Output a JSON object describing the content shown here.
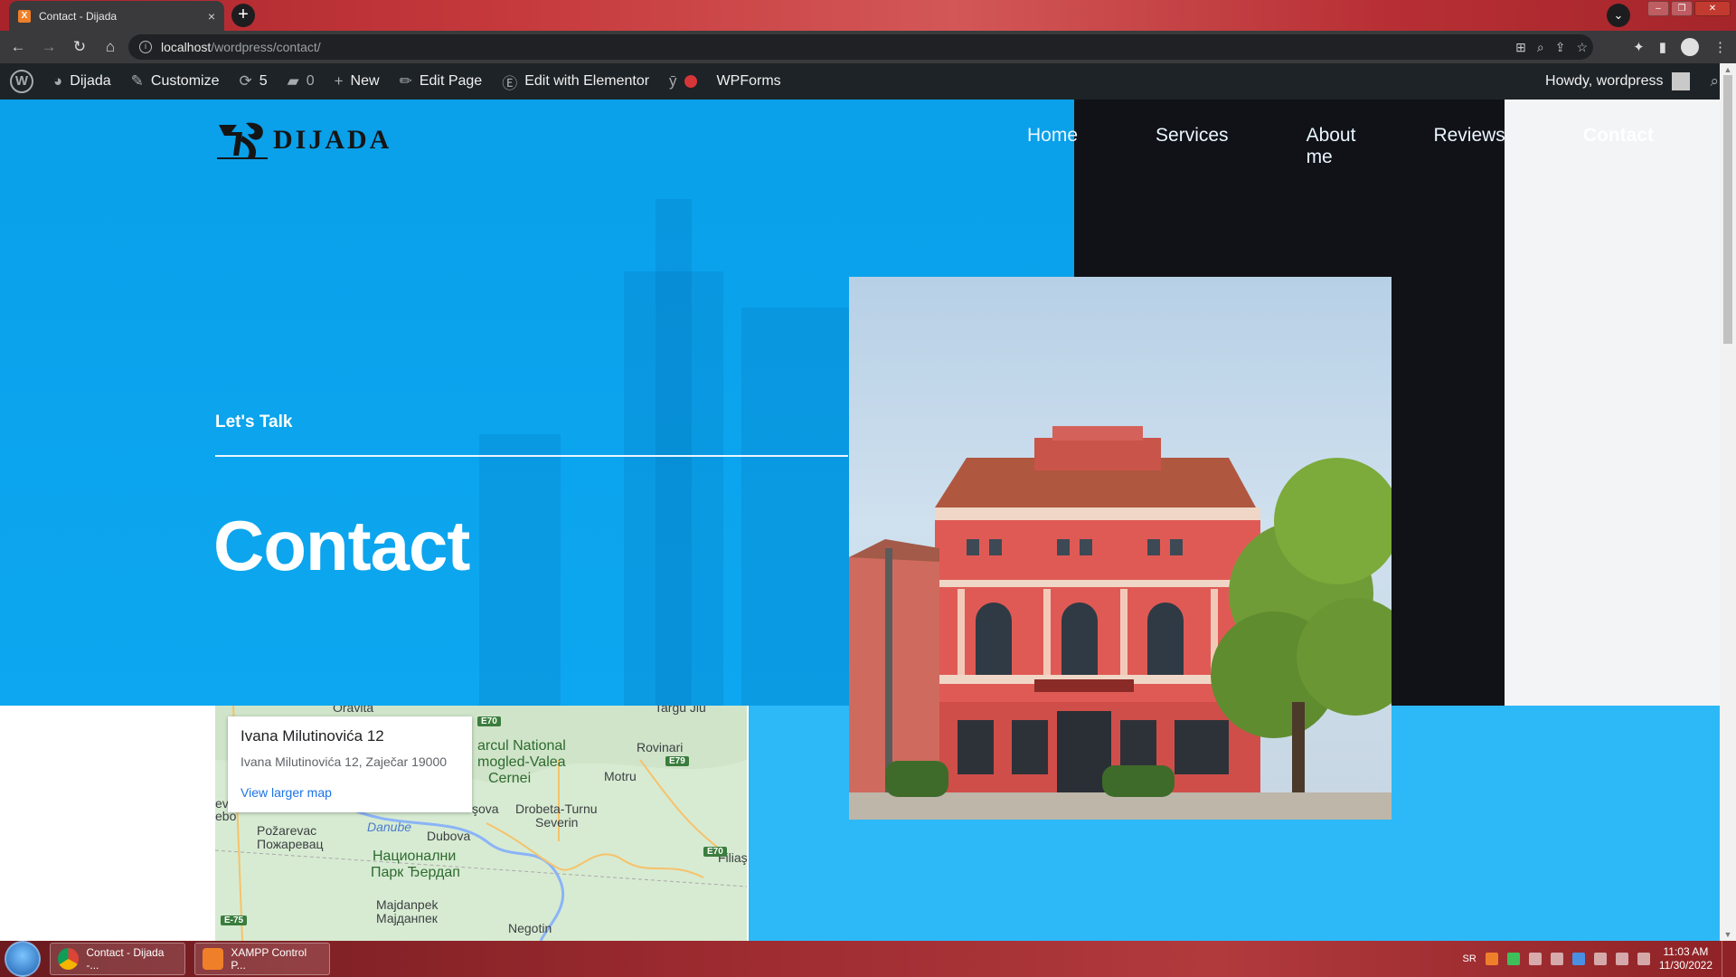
{
  "browser": {
    "tab_title": "Contact - Dijada",
    "tab_close": "×",
    "new_tab": "+",
    "url_host": "localhost",
    "url_path": "/wordpress/contact/"
  },
  "adminbar": {
    "site_name": "Dijada",
    "customize": "Customize",
    "updates_count": "5",
    "comments_count": "0",
    "new": "New",
    "edit_page": "Edit Page",
    "edit_elementor": "Edit with Elementor",
    "wpforms": "WPForms",
    "howdy": "Howdy, wordpress"
  },
  "site": {
    "logo_text": "DIJADA",
    "nav": [
      {
        "label": "Home"
      },
      {
        "label": "Services"
      },
      {
        "label": "About me"
      },
      {
        "label": "Reviews"
      },
      {
        "label": "Contact"
      }
    ],
    "eyebrow": "Let's Talk",
    "headline": "Contact"
  },
  "map": {
    "place_title": "Ivana Milutinovića 12",
    "place_address": "Ivana Milutinovića 12, Zaječar 19000",
    "larger_map_link": "View larger map",
    "labels": {
      "oravita": "Oravita",
      "targu_jiu": "Targu Jiu",
      "parcul": "arcul National",
      "mogled": "mogled-Valea",
      "cernei": "Cernei",
      "rovinari": "Rovinari",
      "motru": "Motru",
      "eu": "ev",
      "ebo": "ebo",
      "orsova": "şova",
      "drobeta": "Drobeta-Turnu",
      "severin": "Severin",
      "pozarevac": "Požarevac",
      "pozarevac_cyr": "Пожаревац",
      "danube": "Danube",
      "dubova": "Dubova",
      "nacionalni": "Национални",
      "park_djerdap": "Парк Ђердап",
      "filias": "Filiaş",
      "majdanpek": "Majdanpek",
      "majdanpek_cyr": "Мајданпек",
      "negotin": "Negotin",
      "e70_a": "E70",
      "e79": "E79",
      "e70_b": "E70",
      "e75": "E-75"
    }
  },
  "taskbar": {
    "task1": "Contact - Dijada -...",
    "task2": "XAMPP Control P...",
    "lang": "SR",
    "time": "11:03 AM",
    "date": "11/30/2022"
  },
  "colors": {
    "hero_blue": "#0aa0ea",
    "bottom_blue": "#2db9f7",
    "nav_dark": "#111217",
    "admin_bar": "#1d2327"
  }
}
